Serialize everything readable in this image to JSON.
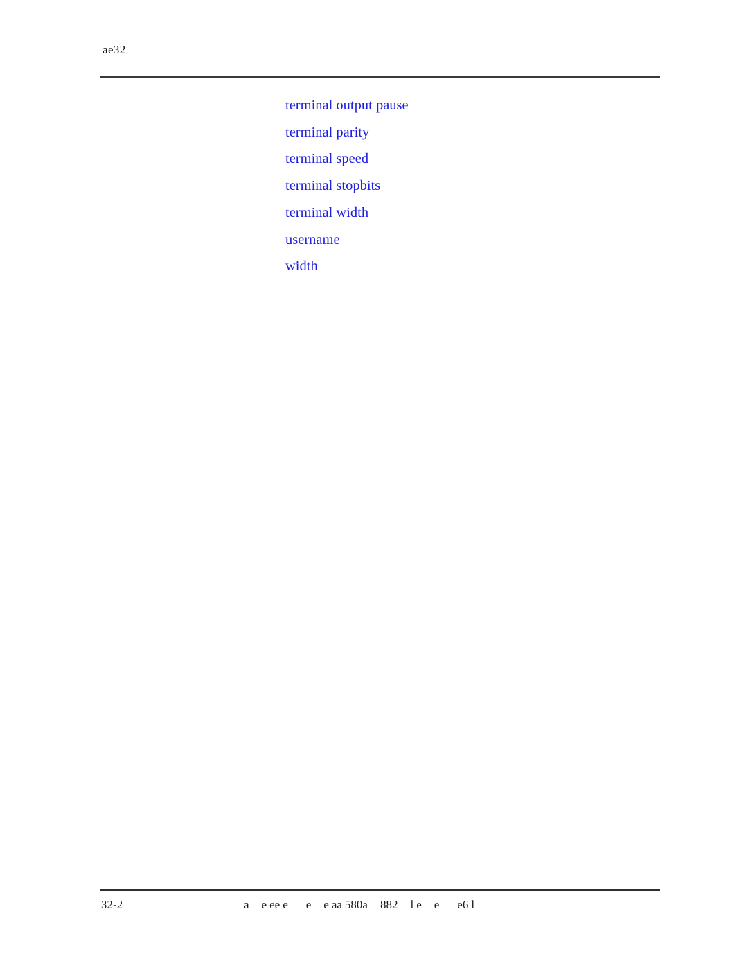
{
  "page": {
    "running_head": "ae32",
    "folio": "32-2",
    "background_color": "#ffffff",
    "rule_color": "#3a3a3a",
    "link_color": "#2020e0",
    "text_color": "#1a1a1a"
  },
  "index_links": [
    {
      "label": "terminal output pause"
    },
    {
      "label": "terminal parity"
    },
    {
      "label": "terminal speed"
    },
    {
      "label": "terminal stopbits"
    },
    {
      "label": "terminal width"
    },
    {
      "label": "username"
    },
    {
      "label": "width"
    }
  ],
  "footer_note": {
    "fragments": [
      {
        "text": "a",
        "gap": ""
      },
      {
        "text": "e",
        "gap": "gap-wide"
      },
      {
        "text": "ee",
        "gap": "gap-tight"
      },
      {
        "text": "e",
        "gap": "gap-tight"
      },
      {
        "text": "e",
        "gap": "gap-xwide"
      },
      {
        "text": "e",
        "gap": "gap-wide"
      },
      {
        "text": "aa",
        "gap": "gap-tight"
      },
      {
        "text": "580a",
        "gap": "gap-tight"
      },
      {
        "text": "882",
        "gap": "gap-wide"
      },
      {
        "text": "l",
        "gap": "gap-wide"
      },
      {
        "text": "e",
        "gap": "gap-tight"
      },
      {
        "text": "e",
        "gap": "gap-wide"
      },
      {
        "text": "e6",
        "gap": "gap-xwide"
      },
      {
        "text": "l",
        "gap": "gap-tight"
      }
    ]
  }
}
